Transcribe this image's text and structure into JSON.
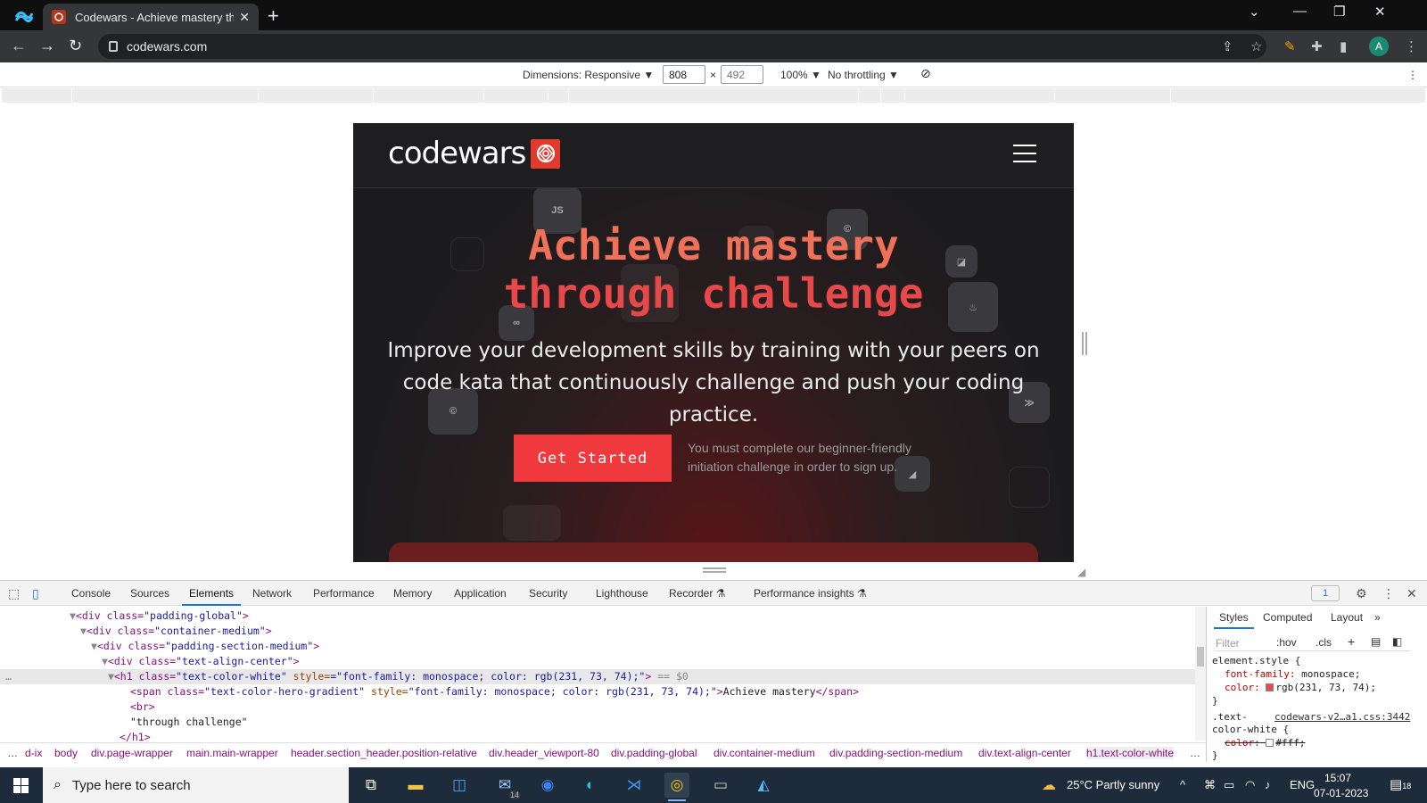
{
  "browser": {
    "tab_title": "Codewars - Achieve mastery thro",
    "tab_close": "✕",
    "new_tab": "+",
    "url": "codewars.com",
    "profile_initial": "A",
    "window_controls": [
      "⌄",
      "—",
      "❐",
      "✕"
    ]
  },
  "device_toolbar": {
    "dimensions_label": "Dimensions: Responsive ▼",
    "width": "808",
    "times": "×",
    "height": "492",
    "zoom": "100% ▼",
    "throttling": "No throttling ▼"
  },
  "page": {
    "brand": "codewars",
    "hero_line1": "Achieve mastery",
    "hero_line2": "through challenge",
    "subtitle": "Improve your development skills by training with your peers on code kata that continuously challenge and push your coding practice.",
    "cta": "Get Started",
    "cta_note": "You must complete our beginner-friendly initiation challenge in order to sign up.",
    "deco_labels": {
      "js": "JS"
    }
  },
  "devtools": {
    "tabs": [
      "Console",
      "Sources",
      "Elements",
      "Network",
      "Performance",
      "Memory",
      "Application",
      "Security",
      "Lighthouse",
      "Recorder ⚗",
      "Performance insights ⚗"
    ],
    "active_tab": "Elements",
    "issues_count": "1",
    "dom_lines": {
      "l1_tag": "<div class=",
      "l1_val": "\"padding-global\"",
      "l2_val": "\"container-medium\"",
      "l3_val": "\"padding-section-medium\"",
      "l4_val": "\"text-align-center\"",
      "l5_open": "<h1 class=",
      "l5_class": "\"text-color-white\"",
      "l5_style_attr": " style=",
      "l5_style_val": "\"font-family: monospace; color: rgb(231, 73, 74);\"",
      "l5_suffix": " == $0",
      "l6_open": "<span class=",
      "l6_class": "\"text-color-hero-gradient\"",
      "l6_style_val": "\"font-family: monospace; color: rgb(231, 73, 74);\"",
      "l6_text": "Achieve mastery",
      "l6_close": "</span>",
      "l7": "<br>",
      "l8": "\"through challenge\"",
      "l9": "</h1>",
      "gt": ">",
      "ellipsis": "…"
    },
    "breadcrumbs": [
      "…",
      "d-ix",
      "body",
      "div.page-wrapper",
      "main.main-wrapper",
      "header.section_header.position-relative",
      "div.header_viewport-80",
      "div.padding-global",
      "div.container-medium",
      "div.padding-section-medium",
      "div.text-align-center",
      "h1.text-color-white",
      "…"
    ],
    "styles_tabs": [
      "Styles",
      "Computed",
      "Layout",
      "»"
    ],
    "filter_placeholder": "Filter",
    "hov": ":hov",
    "cls": ".cls",
    "styles_code": {
      "rule1_selector": "element.style {",
      "rule1_p1": "font-family:",
      "rule1_v1": " monospace;",
      "rule1_p2": "color:",
      "rule1_v2": "rgb(231, 73, 74);",
      "close": "}",
      "rule2_selector": ".text-",
      "rule2_source": "codewars-v2…a1.css:3442",
      "rule2_selector2": "color-white {",
      "rule2_p1": "color:",
      "rule2_v1": "#fff;"
    }
  },
  "taskbar": {
    "search_placeholder": "Type here to search",
    "mail_badge": "14",
    "weather": "25°C  Partly sunny",
    "language": "ENG",
    "time": "15:07",
    "date": "07-01-2023",
    "notif_count": "18"
  },
  "colors": {
    "brand_red": "#e23b2e",
    "cta_red": "#f0393c",
    "hero_red": "#e7494a"
  }
}
